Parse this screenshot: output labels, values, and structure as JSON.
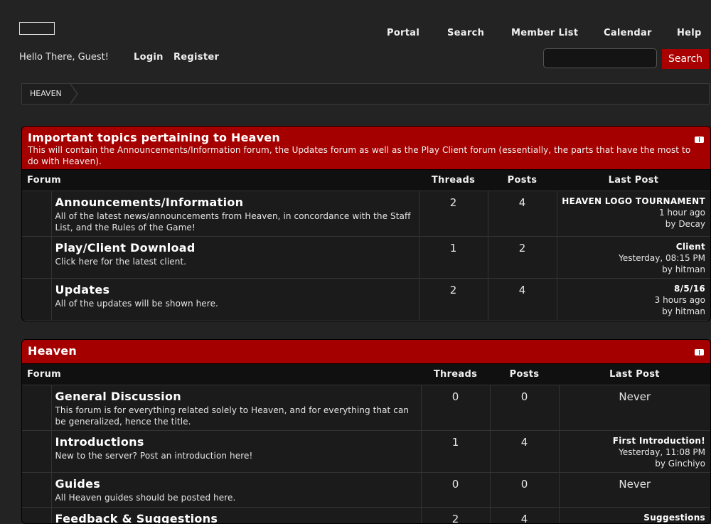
{
  "nav": {
    "portal": "Portal",
    "search": "Search",
    "member_list": "Member List",
    "calendar": "Calendar",
    "help": "Help"
  },
  "guest": {
    "greeting": "Hello There, Guest!",
    "login": "Login",
    "register": "Register"
  },
  "search": {
    "value": "",
    "button": "Search"
  },
  "breadcrumb": {
    "home": "HEAVEN"
  },
  "colors": {
    "accent": "#a50000",
    "background": "#232323"
  },
  "columns": {
    "forum": "Forum",
    "threads": "Threads",
    "posts": "Posts",
    "last_post": "Last Post"
  },
  "categories": [
    {
      "title": "Important topics pertaining to Heaven",
      "description": "This will contain the Announcements/Information forum, the Updates forum as well as the Play Client forum (essentially, the parts that have the most to do with Heaven).",
      "forums": [
        {
          "name": "Announcements/Information",
          "description": "All of the latest news/announcements from Heaven, in concordance with the Staff List, and the Rules of the Game!",
          "threads": "2",
          "posts": "4",
          "last_post": {
            "title": "HEAVEN LOGO TOURNAMENT",
            "time": "1 hour ago",
            "by": "by Decay"
          }
        },
        {
          "name": "Play/Client Download",
          "description": "Click here for the latest client.",
          "threads": "1",
          "posts": "2",
          "last_post": {
            "title": "Client",
            "time": "Yesterday, 08:15 PM",
            "by": "by hitman"
          }
        },
        {
          "name": "Updates",
          "description": "All of the updates will be shown here.",
          "threads": "2",
          "posts": "4",
          "last_post": {
            "title": "8/5/16",
            "time": "3 hours ago",
            "by": "by hitman"
          }
        }
      ]
    },
    {
      "title": "Heaven",
      "description": "",
      "forums": [
        {
          "name": "General Discussion",
          "description": "This forum is for everything related solely to Heaven, and for everything that can be generalized, hence the title.",
          "threads": "0",
          "posts": "0",
          "last_post": {
            "never": "Never"
          }
        },
        {
          "name": "Introductions",
          "description": "New to the server? Post an introduction here!",
          "threads": "1",
          "posts": "4",
          "last_post": {
            "title": "First Introduction!",
            "time": "Yesterday, 11:08 PM",
            "by": "by Ginchiyo"
          }
        },
        {
          "name": "Guides",
          "description": "All Heaven guides should be posted here.",
          "threads": "0",
          "posts": "0",
          "last_post": {
            "never": "Never"
          }
        },
        {
          "name": "Feedback & Suggestions",
          "description": "",
          "threads": "2",
          "posts": "4",
          "last_post": {
            "title": "Suggestions",
            "time": "",
            "by": ""
          }
        }
      ]
    }
  ]
}
